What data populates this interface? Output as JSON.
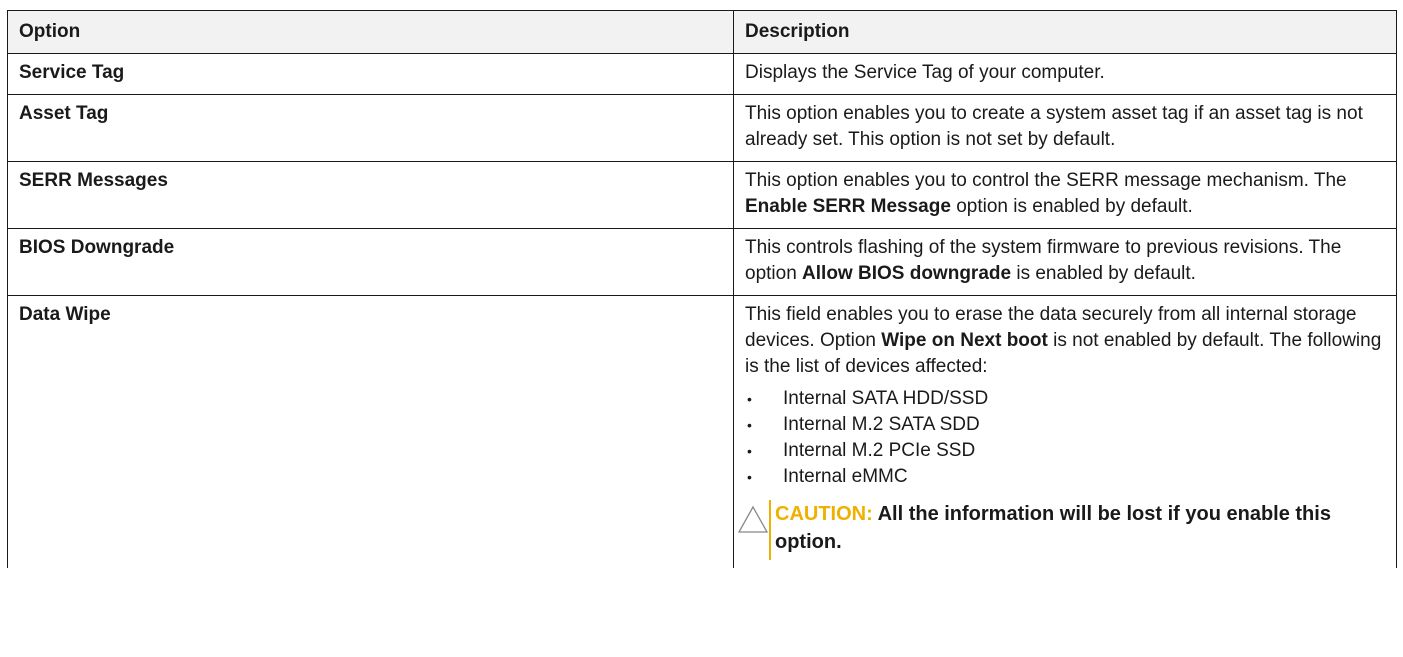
{
  "table": {
    "headers": {
      "option": "Option",
      "description": "Description"
    },
    "rows": [
      {
        "option": "Service Tag",
        "description": [
          {
            "t": "Displays the Service Tag of your computer."
          }
        ]
      },
      {
        "option": "Asset Tag",
        "description": [
          {
            "t": "This option enables you to create a system asset tag if an asset tag is not already set. This option is not set by default."
          }
        ]
      },
      {
        "option": "SERR Messages",
        "description": [
          {
            "t": "This option enables you to control the SERR message mechanism. The "
          },
          {
            "t": "Enable SERR Message",
            "bold": true
          },
          {
            "t": " option is enabled by default."
          }
        ]
      },
      {
        "option": "BIOS Downgrade",
        "description": [
          {
            "t": "This controls flashing of the system firmware to previous revisions. The option "
          },
          {
            "t": "Allow BIOS downgrade",
            "bold": true
          },
          {
            "t": " is enabled by default."
          }
        ]
      },
      {
        "option": "Data Wipe",
        "description": [
          {
            "t": "This field enables you to erase the data securely from all internal storage devices. Option "
          },
          {
            "t": "Wipe on Next boot",
            "bold": true
          },
          {
            "t": " is not enabled by default. The following is the list of devices affected:"
          }
        ],
        "bullets": [
          "Internal SATA HDD/SSD",
          "Internal M.2 SATA SDD",
          "Internal M.2 PCIe SSD",
          "Internal eMMC"
        ],
        "caution": {
          "label": "CAUTION:",
          "text": " All the information will be lost if you enable this option."
        }
      }
    ]
  },
  "colors": {
    "caution": "#f0b000",
    "border": "#1a1a1a",
    "header_bg": "#f2f2f2"
  },
  "icons": {
    "caution": "caution-triangle-icon",
    "bullet": "bullet-dot-icon"
  }
}
